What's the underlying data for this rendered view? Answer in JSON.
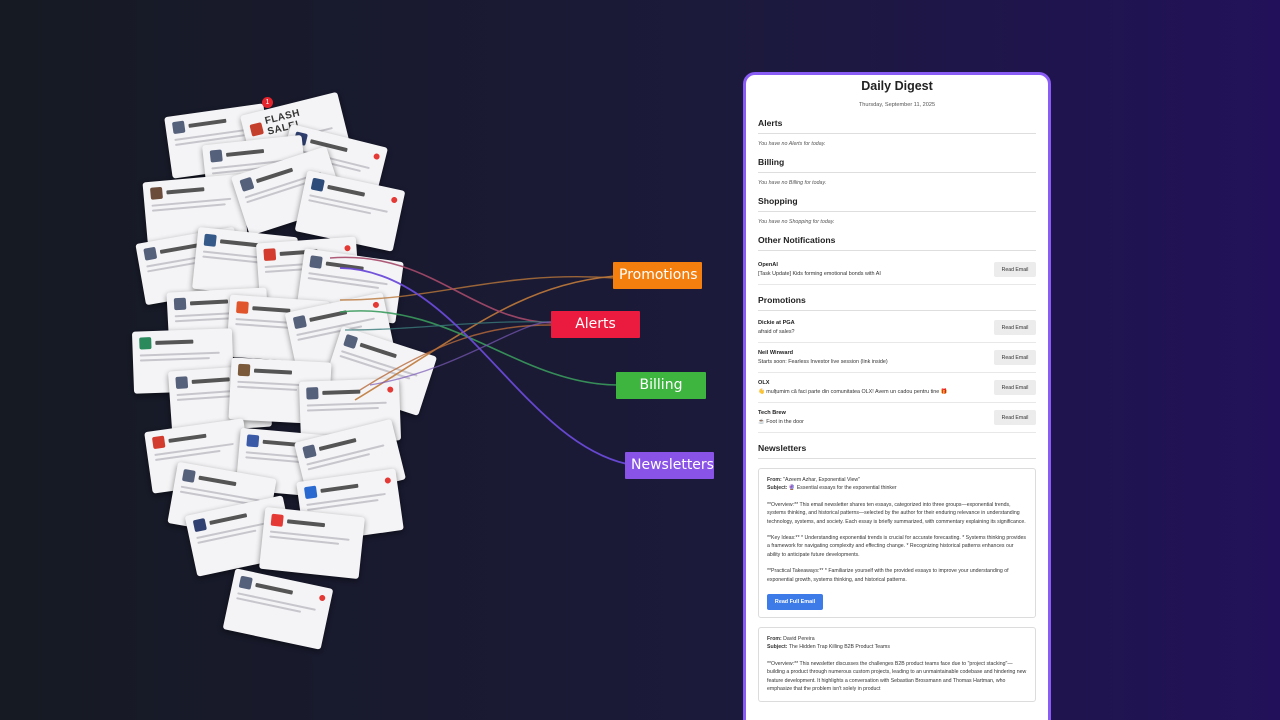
{
  "pile": {
    "flash_sale_text": "FLASH SALE!",
    "badge_count": "1"
  },
  "tags": {
    "promotions": {
      "label": "Promotions",
      "color": "#f57f0e"
    },
    "alerts": {
      "label": "Alerts",
      "color": "#ea1b3e"
    },
    "billing": {
      "label": "Billing",
      "color": "#3db53f"
    },
    "newsletters": {
      "label": "Newsletters",
      "color": "#8a53e8"
    }
  },
  "digest": {
    "title": "Daily Digest",
    "date": "Thursday, September 11, 2025",
    "alerts": {
      "title": "Alerts",
      "empty": "You have no Alerts for today."
    },
    "billing": {
      "title": "Billing",
      "empty": "You have no Billing for today."
    },
    "shopping": {
      "title": "Shopping",
      "empty": "You have no Shopping for today."
    },
    "other": {
      "title": "Other Notifications",
      "items": [
        {
          "from": "OpenAI",
          "subject": "[Task Update] Kids forming emotional bonds with AI",
          "button": "Read Email"
        }
      ]
    },
    "promotions": {
      "title": "Promotions",
      "items": [
        {
          "from": "Dickie at PGA",
          "subject": "afraid of sales?",
          "button": "Read Email"
        },
        {
          "from": "Neil Winward",
          "subject": "Starts soon: Fearless Investor live session (link inside)",
          "button": "Read Email"
        },
        {
          "from": "OLX",
          "subject": "👋 mulțumim că faci parte din comunitatea OLX! Avem un cadou pentru tine 🎁",
          "button": "Read Email"
        },
        {
          "from": "Tech Brew",
          "subject": "☕ Foot in the door",
          "button": "Read Email"
        }
      ]
    },
    "newsletters": {
      "title": "Newsletters",
      "cards": [
        {
          "from_label": "From:",
          "from": "\"Azeem Azhar, Exponential View\"",
          "subject_label": "Subject:",
          "subject": "🔮 Essential essays for the exponential thinker",
          "overview": "**Overview:** This email newsletter shares ten essays, categorized into three groups—exponential trends, systems thinking, and historical patterns—selected by the author for their enduring relevance in understanding technology, systems, and society. Each essay is briefly summarized, with commentary explaining its significance.",
          "key_ideas": "**Key Ideas:** * Understanding exponential trends is crucial for accurate forecasting. * Systems thinking provides a framework for navigating complexity and effecting change. * Recognizing historical patterns enhances our ability to anticipate future developments.",
          "takeaways": "**Practical Takeaways:** * Familiarize yourself with the provided essays to improve your understanding of exponential growth, systems thinking, and historical patterns.",
          "button": "Read Full Email"
        },
        {
          "from_label": "From:",
          "from": "David Pereira",
          "subject_label": "Subject:",
          "subject": "The Hidden Trap Killing B2B Product Teams",
          "overview": "**Overview:** This newsletter discusses the challenges B2B product teams face due to \"project stacking\"—building a product through numerous custom projects, leading to an unmaintainable codebase and hindering new feature development. It highlights a conversation with Sebastian Brossmann and Thomas Hartman, who emphasize that the problem isn't solely in product"
        }
      ]
    }
  }
}
